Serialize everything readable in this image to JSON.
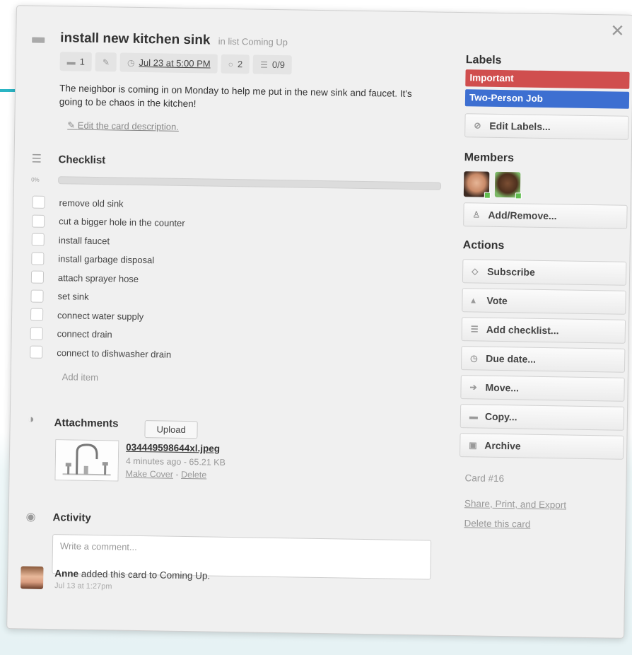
{
  "card": {
    "title": "install new kitchen sink",
    "in_list": "in list Coming Up",
    "badges": {
      "comments": "1",
      "due": "Jul 23 at 5:00 PM",
      "votes": "2",
      "checklist": "0/9"
    },
    "description": "The neighbor is coming in on Monday to help me put in the new sink and faucet. It's going to be chaos in the kitchen!",
    "edit_description": "Edit the card description."
  },
  "checklist": {
    "title": "Checklist",
    "percent_label": "0%",
    "progress": 0,
    "items": [
      {
        "label": "remove old sink",
        "checked": false
      },
      {
        "label": "cut a bigger hole in the counter",
        "checked": false
      },
      {
        "label": "install faucet",
        "checked": false
      },
      {
        "label": "install garbage disposal",
        "checked": false
      },
      {
        "label": "attach sprayer hose",
        "checked": false
      },
      {
        "label": "set sink",
        "checked": false
      },
      {
        "label": "connect water supply",
        "checked": false
      },
      {
        "label": "connect drain",
        "checked": false
      },
      {
        "label": "connect to dishwasher drain",
        "checked": false
      }
    ],
    "add_item": "Add item"
  },
  "attachments": {
    "title": "Attachments",
    "upload": "Upload",
    "file": {
      "name": "034449598644xl.jpeg",
      "meta": "4 minutes ago - 65.21 KB",
      "make_cover": "Make Cover",
      "separator": " - ",
      "delete": "Delete"
    }
  },
  "activity": {
    "title": "Activity",
    "comment_placeholder": "Write a comment...",
    "entry": {
      "user": "Anne",
      "text": " added this card to Coming Up.",
      "time": "Jul 13 at 1:27pm"
    }
  },
  "sidebar": {
    "labels_title": "Labels",
    "labels": [
      {
        "name": "Important",
        "color": "#d04e4e"
      },
      {
        "name": "Two-Person Job",
        "color": "#3d6fd1"
      }
    ],
    "edit_labels": "Edit Labels...",
    "members_title": "Members",
    "add_remove": "Add/Remove...",
    "actions_title": "Actions",
    "actions": {
      "subscribe": "Subscribe",
      "vote": "Vote",
      "add_checklist": "Add checklist...",
      "due_date": "Due date...",
      "move": "Move...",
      "copy": "Copy...",
      "archive": "Archive"
    },
    "card_number": "Card #16",
    "share": "Share, Print, and Export",
    "delete_card": "Delete this card"
  },
  "icons": {
    "close": "close-icon",
    "annotation_arrow": "arrow-icon"
  },
  "colors": {
    "accent_arrow": "#2bb5c4",
    "label_important": "#d04e4e",
    "label_two_person": "#3d6fd1"
  }
}
